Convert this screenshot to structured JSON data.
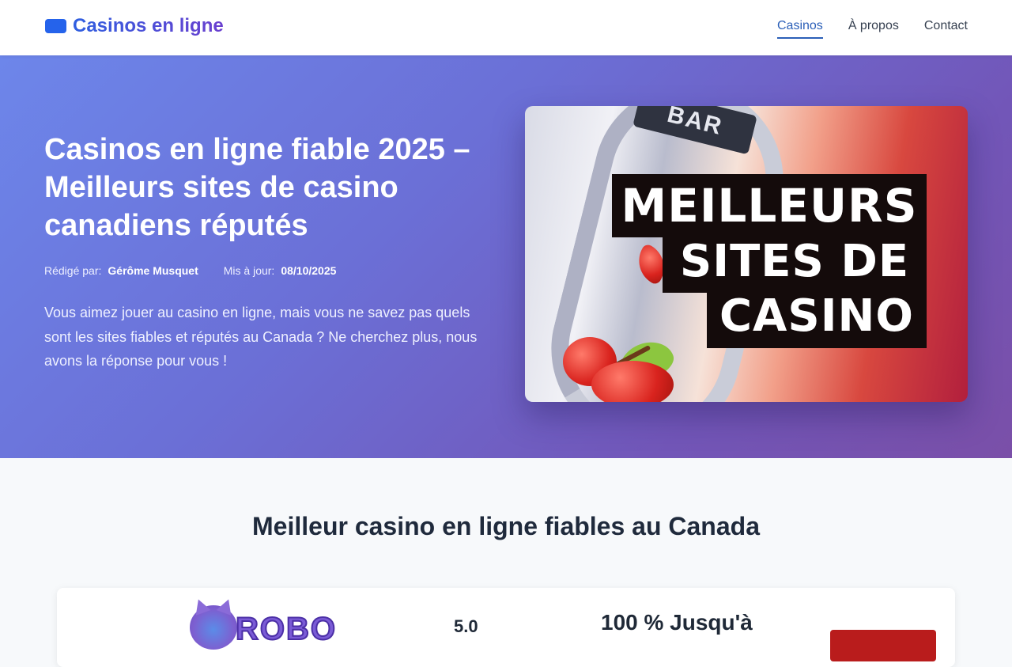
{
  "header": {
    "logo_text": "Casinos en ligne",
    "nav": [
      {
        "label": "Casinos",
        "active": true
      },
      {
        "label": "À propos",
        "active": false
      },
      {
        "label": "Contact",
        "active": false
      }
    ]
  },
  "hero": {
    "title": "Casinos en ligne fiable 2025 – Meilleurs sites de casino canadiens réputés",
    "author_label": "Rédigé par:",
    "author": "Gérôme Musquet",
    "updated_label": "Mis à jour:",
    "updated": "08/10/2025",
    "description": "Vous aimez jouer au casino en ligne, mais vous ne savez pas quels sont les sites fiables et réputés au Canada ? Ne cherchez plus, nous avons la réponse pour vous !",
    "image": {
      "bar_text": "BAR",
      "sign_lines": [
        "MEILLEURS",
        "SITES DE",
        "CASINO"
      ]
    }
  },
  "section": {
    "title": "Meilleur casino en ligne fiables au Canada",
    "cards": [
      {
        "brand_partial": "ROBO",
        "rating": "5.0",
        "bonus": "100 % Jusqu'à"
      }
    ]
  },
  "colors": {
    "accent": "#2563eb",
    "nav_active": "#2b5fb8",
    "hero_start": "#6d86ea",
    "hero_end": "#7a4fa8",
    "cta": "#b91c1c"
  }
}
